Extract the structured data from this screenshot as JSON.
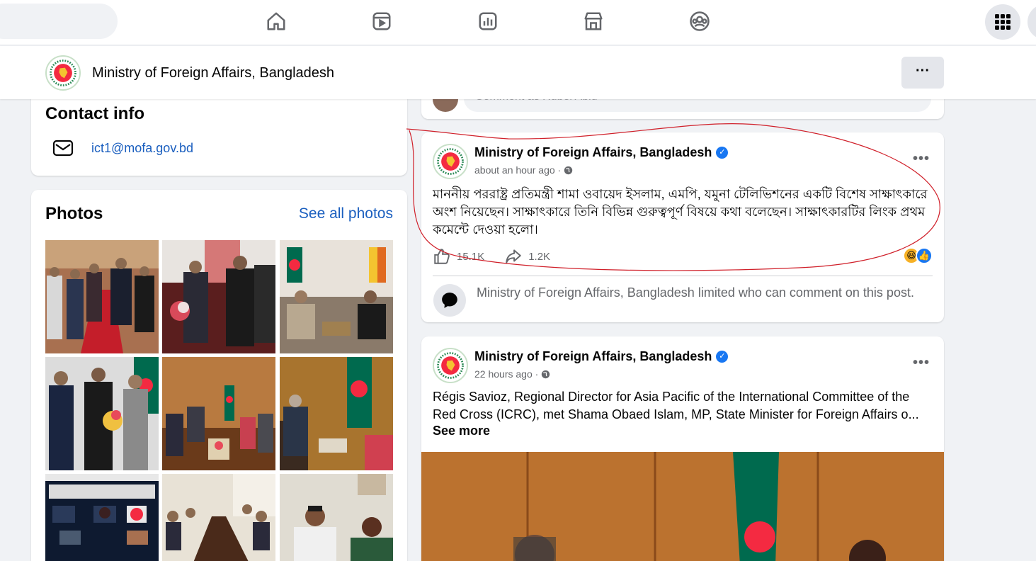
{
  "nav": {
    "icons": [
      "home-icon",
      "video-icon",
      "insights-icon",
      "marketplace-icon",
      "groups-icon",
      "menu-grid-icon"
    ]
  },
  "page_header": {
    "title": "Ministry of Foreign Affairs, Bangladesh",
    "more_label": "···"
  },
  "contact": {
    "heading": "Contact info",
    "email": "ict1@mofa.gov.bd"
  },
  "photos": {
    "heading": "Photos",
    "see_all": "See all photos"
  },
  "comment_bar": {
    "placeholder": "Comment as Rubel Abid"
  },
  "posts": [
    {
      "author": "Ministry of Foreign Affairs, Bangladesh",
      "time": "about an hour ago ·",
      "body": "মাননীয় পররাষ্ট্র প্রতিমন্ত্রী শামা ওবায়েদ ইসলাম, এমপি, যমুনা টেলিভিশনের একটি বিশেষ সাক্ষাৎকারে অংশ নিয়েছেন। সাক্ষাৎকারে তিনি বিভিন্ন গুরুত্বপূর্ণ বিষয়ে কথা বলেছেন। সাক্ষাৎকারটির লিংক প্রথম কমেন্টে দেওয়া হলো।",
      "likes": "15.1K",
      "shares": "1.2K",
      "limited_notice": "Ministry of Foreign Affairs, Bangladesh limited who can comment on this post."
    },
    {
      "author": "Ministry of Foreign Affairs, Bangladesh",
      "time": "22 hours ago ·",
      "body": "Régis Savioz, Regional Director for Asia Pacific of the International Committee of the Red Cross (ICRC), met Shama Obaed Islam, MP, State Minister for Foreign Affairs o...",
      "see_more": "See more"
    }
  ],
  "colors": {
    "brand_blue": "#1877f2",
    "link_blue": "#1b5fbf",
    "annotation_red": "#d0202a",
    "flag_green": "#006a4e",
    "flag_red": "#f42a41"
  }
}
